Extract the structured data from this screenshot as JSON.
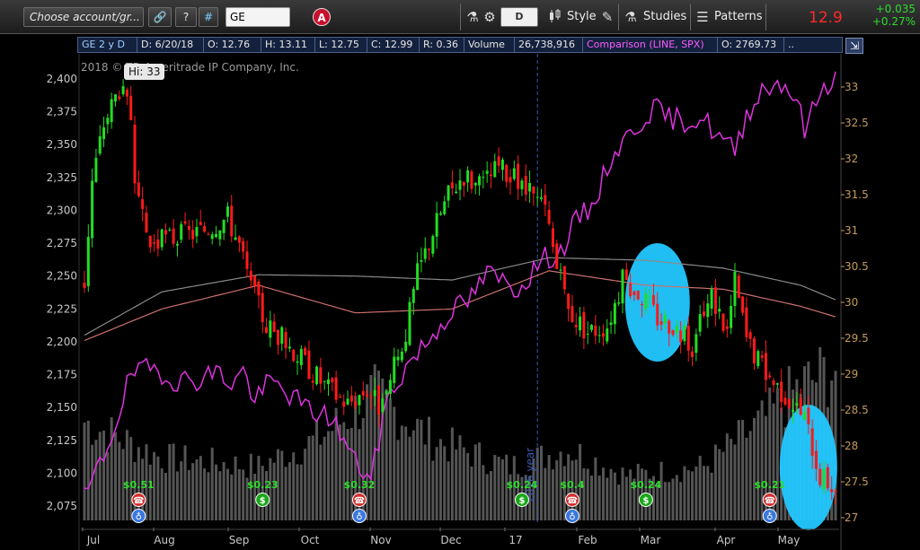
{
  "toolbar": {
    "account_label": "Choose account/gr...",
    "help_label": "?",
    "hash_label": "#",
    "symbol_value": "GE",
    "account_badge": "A",
    "period_label": "D",
    "style_label": "Style",
    "studies_label": "Studies",
    "patterns_label": "Patterns",
    "last_price": "12.9",
    "net_change": "+0.035",
    "pct_change": "+0.27%",
    "icons": [
      "link-icon",
      "flask-icon",
      "gear-icon",
      "candle-icon",
      "pencil-icon",
      "flask-icon",
      "patterns-icon"
    ]
  },
  "infobar": {
    "name": "GE 2 y D",
    "date": "D: 6/20/18",
    "open": "O: 12.76",
    "high": "H: 13.11",
    "low": "L: 12.75",
    "close": "C: 12.99",
    "range": "R: 0.36",
    "volume_label": "Volume",
    "volume_value": "26,738,916",
    "comparison": "Comparison (LINE, SPX)",
    "comparison_open": "O: 2769.73",
    "more": ".."
  },
  "chart_header": {
    "copyright": "2018 © TD Ameritrade IP Company, Inc.",
    "hi_label": "Hi: 33"
  },
  "colors": {
    "up_candle": "#22dd22",
    "down_candle": "#ff1a1a",
    "comparison_line": "#dd33dd",
    "ma_short": "#cc7070",
    "ma_long": "#8a8a8a",
    "volume": "#555555",
    "highlight": "#22c8ff",
    "left_axis": "#c8c8c8",
    "right_axis": "#c49a5a",
    "year_marker": "#3b5bb0"
  },
  "chart_data": {
    "type": "candlestick",
    "x_ticks": [
      "Jul",
      "Aug",
      "Sep",
      "Oct",
      "Nov",
      "Dec",
      "17",
      "Feb",
      "Mar",
      "Apr",
      "May"
    ],
    "left_axis": {
      "ticks": [
        "2,400",
        "2,375",
        "2,350",
        "2,325",
        "2,300",
        "2,275",
        "2,250",
        "2,225",
        "2,200",
        "2,175",
        "2,150",
        "2,125",
        "2,100",
        "2,075"
      ],
      "range": [
        2075,
        2400
      ]
    },
    "right_axis": {
      "ticks": [
        "33",
        "32.5",
        "32",
        "31.5",
        "31",
        "30.5",
        "30",
        "29.5",
        "29",
        "28.5",
        "28",
        "27.5",
        "27"
      ],
      "range": [
        27,
        33
      ]
    },
    "year_marker_label": "2016 year",
    "price_anchors": [
      [
        0,
        30.3
      ],
      [
        2,
        31.7
      ],
      [
        5,
        32.5
      ],
      [
        9,
        33.0
      ],
      [
        12,
        32.6
      ],
      [
        13,
        31.5
      ],
      [
        17,
        30.8
      ],
      [
        22,
        30.9
      ],
      [
        30,
        31.0
      ],
      [
        37,
        31.2
      ],
      [
        40,
        30.8
      ],
      [
        43,
        30.2
      ],
      [
        47,
        29.7
      ],
      [
        53,
        29.4
      ],
      [
        58,
        29.1
      ],
      [
        63,
        28.8
      ],
      [
        68,
        28.6
      ],
      [
        73,
        28.8
      ],
      [
        77,
        28.5
      ],
      [
        79,
        28.9
      ],
      [
        83,
        29.6
      ],
      [
        86,
        30.4
      ],
      [
        90,
        31.0
      ],
      [
        94,
        31.5
      ],
      [
        98,
        31.8
      ],
      [
        102,
        31.6
      ],
      [
        107,
        31.9
      ],
      [
        111,
        31.7
      ],
      [
        115,
        31.5
      ],
      [
        119,
        31.3
      ],
      [
        122,
        30.5
      ],
      [
        125,
        29.9
      ],
      [
        130,
        29.6
      ],
      [
        135,
        29.7
      ],
      [
        139,
        30.3
      ],
      [
        144,
        30.1
      ],
      [
        148,
        29.8
      ],
      [
        152,
        29.7
      ],
      [
        157,
        29.4
      ],
      [
        162,
        30.1
      ],
      [
        166,
        29.6
      ],
      [
        168,
        30.3
      ],
      [
        171,
        29.5
      ],
      [
        174,
        29.2
      ],
      [
        178,
        28.9
      ],
      [
        183,
        28.6
      ],
      [
        186,
        28.4
      ],
      [
        190,
        27.6
      ],
      [
        194,
        27.4
      ]
    ],
    "comparison_anchors": [
      [
        0,
        2080
      ],
      [
        6,
        2120
      ],
      [
        12,
        2175
      ],
      [
        18,
        2180
      ],
      [
        24,
        2170
      ],
      [
        30,
        2172
      ],
      [
        34,
        2178
      ],
      [
        38,
        2168
      ],
      [
        41,
        2178
      ],
      [
        44,
        2155
      ],
      [
        48,
        2170
      ],
      [
        53,
        2160
      ],
      [
        58,
        2148
      ],
      [
        64,
        2142
      ],
      [
        70,
        2108
      ],
      [
        74,
        2095
      ],
      [
        78,
        2155
      ],
      [
        84,
        2185
      ],
      [
        90,
        2205
      ],
      [
        95,
        2225
      ],
      [
        99,
        2230
      ],
      [
        104,
        2252
      ],
      [
        109,
        2245
      ],
      [
        112,
        2240
      ],
      [
        118,
        2262
      ],
      [
        123,
        2268
      ],
      [
        127,
        2292
      ],
      [
        131,
        2302
      ],
      [
        136,
        2340
      ],
      [
        142,
        2362
      ],
      [
        147,
        2378
      ],
      [
        151,
        2370
      ],
      [
        156,
        2368
      ],
      [
        160,
        2370
      ],
      [
        163,
        2358
      ],
      [
        168,
        2345
      ],
      [
        171,
        2373
      ],
      [
        175,
        2392
      ],
      [
        180,
        2398
      ],
      [
        184,
        2385
      ],
      [
        186,
        2360
      ],
      [
        190,
        2390
      ],
      [
        194,
        2403
      ]
    ],
    "ma_long_anchors": [
      [
        0,
        2205
      ],
      [
        20,
        2238
      ],
      [
        45,
        2251
      ],
      [
        70,
        2250
      ],
      [
        95,
        2247
      ],
      [
        120,
        2264
      ],
      [
        145,
        2262
      ],
      [
        165,
        2256
      ],
      [
        185,
        2243
      ],
      [
        194,
        2232
      ]
    ],
    "ma_short_anchors": [
      [
        0,
        2201
      ],
      [
        20,
        2225
      ],
      [
        45,
        2243
      ],
      [
        70,
        2222
      ],
      [
        95,
        2225
      ],
      [
        120,
        2254
      ],
      [
        145,
        2243
      ],
      [
        165,
        2240
      ],
      [
        185,
        2227
      ],
      [
        194,
        2219
      ]
    ],
    "volume_profile": [
      [
        0,
        0.55
      ],
      [
        20,
        0.35
      ],
      [
        45,
        0.3
      ],
      [
        60,
        0.45
      ],
      [
        75,
        0.7
      ],
      [
        90,
        0.45
      ],
      [
        110,
        0.3
      ],
      [
        125,
        0.4
      ],
      [
        140,
        0.25
      ],
      [
        160,
        0.3
      ],
      [
        175,
        0.55
      ],
      [
        185,
        0.75
      ],
      [
        194,
        0.85
      ]
    ],
    "dividends": [
      {
        "bar": 14,
        "value": "$0.51",
        "icons": [
          "calls-icon",
          "earnings-icon"
        ]
      },
      {
        "bar": 46,
        "value": "$0.23",
        "icons": [
          "dividend-icon"
        ]
      },
      {
        "bar": 71,
        "value": "$0.32",
        "icons": [
          "calls-icon",
          "earnings-icon"
        ]
      },
      {
        "bar": 113,
        "value": "$0.24",
        "icons": [
          "dividend-icon"
        ]
      },
      {
        "bar": 126,
        "value": "$0.4",
        "icons": [
          "calls-icon",
          "earnings-icon"
        ]
      },
      {
        "bar": 145,
        "value": "$0.24",
        "icons": [
          "dividend-icon"
        ]
      },
      {
        "bar": 177,
        "value": "$0.21",
        "icons": [
          "calls-icon",
          "earnings-icon"
        ]
      }
    ],
    "highlights": [
      {
        "bar_center": 148,
        "price_center": 30.0
      },
      {
        "bar_center": 187,
        "price_center": 27.7
      }
    ],
    "num_bars": 195
  }
}
